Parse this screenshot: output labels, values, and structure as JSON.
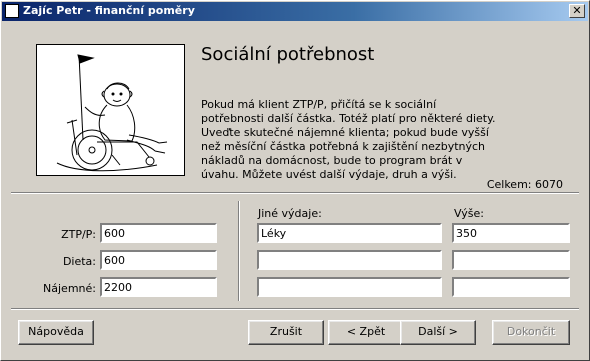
{
  "window": {
    "title": "Zajíc Petr - finanční poměry",
    "close_icon": "close-icon"
  },
  "page": {
    "heading": "Sociální potřebnost",
    "description": "Pokud má klient ZTP/P, přičítá se k sociální potřebnosti další částka. Totéž platí pro některé diety. Uveďte skutečné nájemné klienta; pokud bude vyšší než měsíční částka potřebná k zajištění nezbytných nákladů na domácnost, bude to program brát v úvahu. Můžete uvést další výdaje, druh a výši.",
    "total_label": "Celkem:",
    "total_value": "6070"
  },
  "left_fields": [
    {
      "label": "ZTP/P:",
      "value": "600"
    },
    {
      "label": "Dieta:",
      "value": "600"
    },
    {
      "label": "Nájemné:",
      "value": "2200"
    }
  ],
  "other_expenses": {
    "type_header": "Jiné výdaje:",
    "amount_header": "Výše:",
    "rows": [
      {
        "type": "Léky",
        "amount": "350"
      },
      {
        "type": "",
        "amount": ""
      },
      {
        "type": "",
        "amount": ""
      }
    ]
  },
  "buttons": {
    "help": "Nápověda",
    "cancel": "Zrušit",
    "back": "< Zpět",
    "next": "Další >",
    "finish": "Dokončit"
  },
  "illustration": "wheelchair-person-with-flag"
}
